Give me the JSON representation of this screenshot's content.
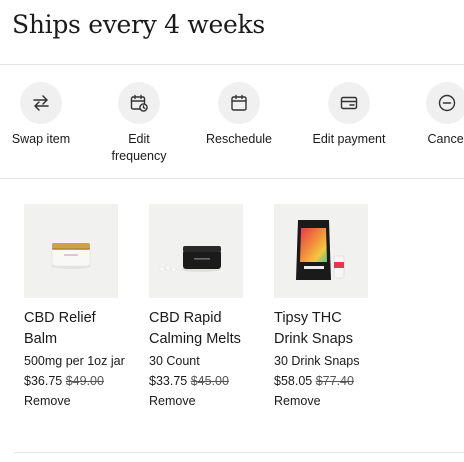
{
  "header": {
    "title": "Ships every 4 weeks"
  },
  "actions": [
    {
      "label": "Swap item",
      "icon": "swap-arrows-icon"
    },
    {
      "label": "Edit\nfrequency",
      "icon": "calendar-clock-icon"
    },
    {
      "label": "Reschedule",
      "icon": "calendar-icon"
    },
    {
      "label": "Edit payment",
      "icon": "wallet-card-icon"
    },
    {
      "label": "Cancel",
      "icon": "minus-circle-icon"
    }
  ],
  "products": [
    {
      "name": "CBD Relief Balm",
      "variant": "500mg per 1oz jar",
      "price": "$36.75",
      "original_price": "$49.00",
      "remove_label": "Remove"
    },
    {
      "name": "CBD Rapid Calming Melts",
      "variant": "30 Count",
      "price": "$33.75",
      "original_price": "$45.00",
      "remove_label": "Remove"
    },
    {
      "name": "Tipsy THC Drink Snaps",
      "variant": "30 Drink Snaps",
      "price": "$58.05",
      "original_price": "$77.40",
      "remove_label": "Remove"
    }
  ],
  "colors": {
    "text": "#1a1a1a",
    "icon_bg": "#f0f0f0",
    "thumb_bg": "#f1f1f0",
    "divider": "#e6e6e6"
  }
}
